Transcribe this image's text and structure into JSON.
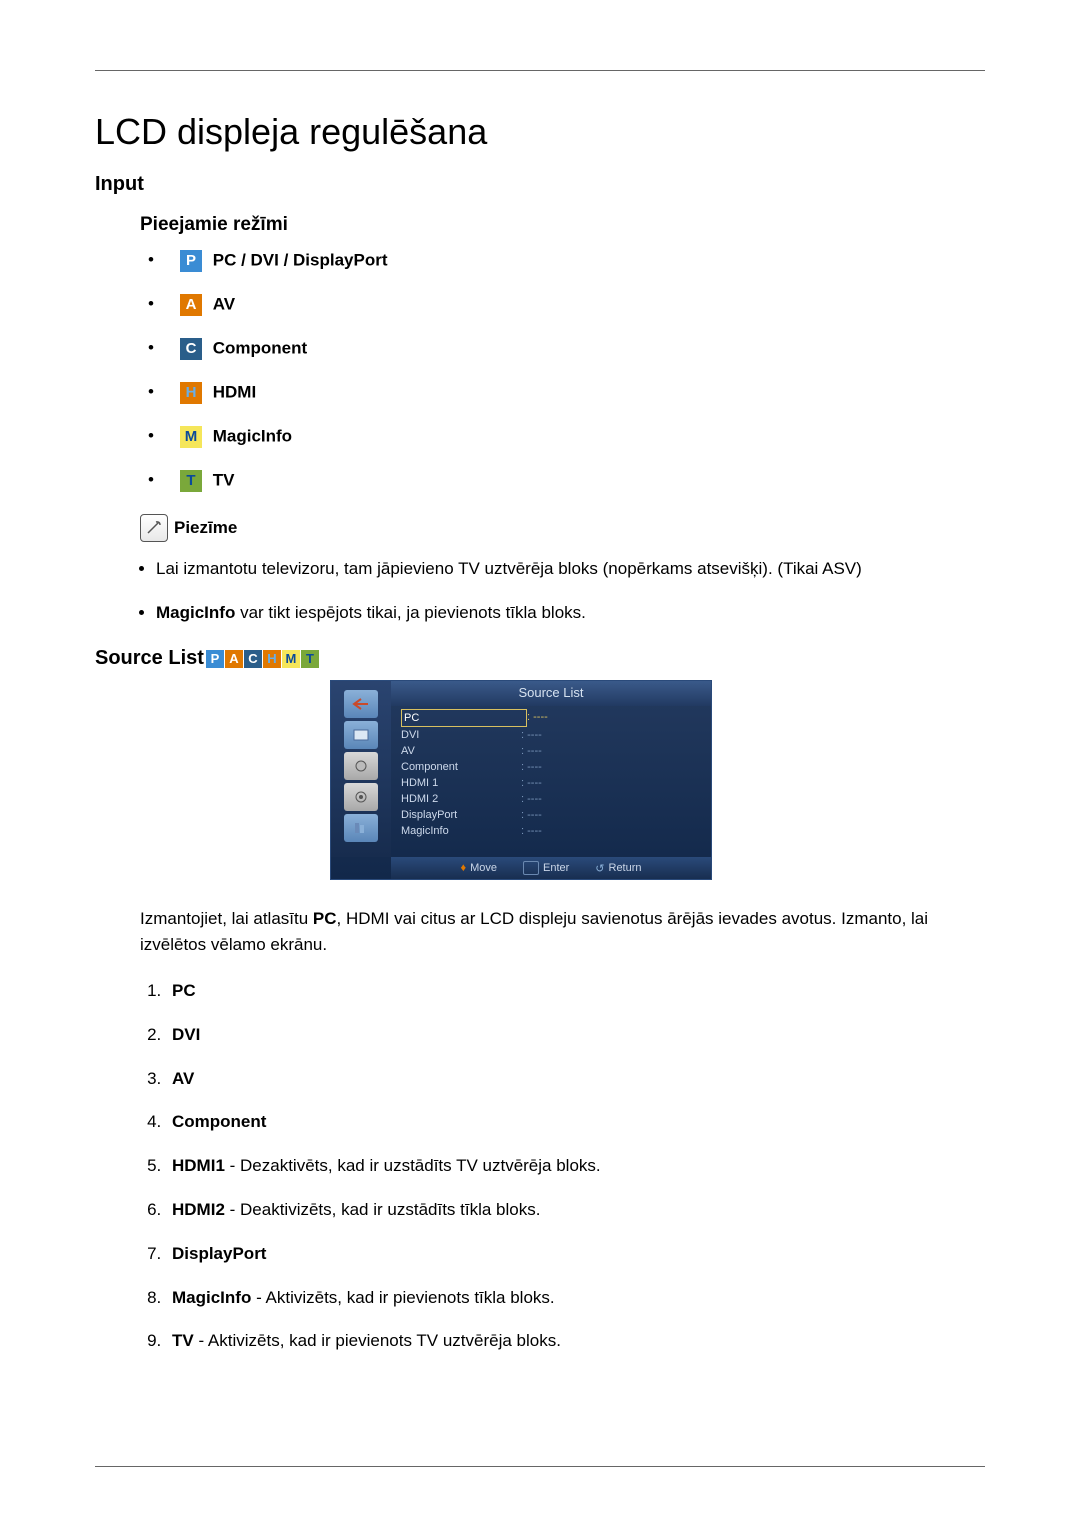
{
  "title": "LCD displeja regulēšana",
  "input": {
    "heading": "Input",
    "modes_heading": "Pieejamie režīmi",
    "modes": {
      "pc": "PC / DVI / DisplayPort",
      "av": "AV",
      "component": "Component",
      "hdmi": "HDMI",
      "magicinfo": "MagicInfo",
      "tv": "TV"
    },
    "note_label": "Piezīme",
    "notes": {
      "n1": "Lai izmantotu televizoru, tam jāpievieno TV uztvērēja bloks (nopērkams atsevišķi). (Tikai ASV)",
      "n2_bold": "MagicInfo",
      "n2_rest": " var tikt iespējots tikai, ja pievienots tīkla bloks."
    }
  },
  "source_list": {
    "heading": "Source List",
    "osd_title": "Source List",
    "osd_items": {
      "i0": {
        "label": "PC",
        "val": ": ----"
      },
      "i1": {
        "label": "DVI",
        "val": ": ----"
      },
      "i2": {
        "label": "AV",
        "val": ": ----"
      },
      "i3": {
        "label": "Component",
        "val": ": ----"
      },
      "i4": {
        "label": "HDMI 1",
        "val": ": ----"
      },
      "i5": {
        "label": "HDMI 2",
        "val": ": ----"
      },
      "i6": {
        "label": "DisplayPort",
        "val": ": ----"
      },
      "i7": {
        "label": "MagicInfo",
        "val": ": ----"
      }
    },
    "osd_hints": {
      "move": "Move",
      "enter": "Enter",
      "ret": "Return"
    },
    "intro_pre": "Izmantojiet, lai atlasītu ",
    "intro_bold": "PC",
    "intro_post": ", HDMI vai citus ar LCD displeju savienotus ārējās ievades avotus. Izmanto, lai izvēlētos vēlamo ekrānu.",
    "list": {
      "l1": "PC",
      "l2": "DVI",
      "l3": "AV",
      "l4": "Component",
      "l5b": "HDMI1",
      "l5r": " - Dezaktivēts, kad ir uzstādīts TV uztvērēja bloks.",
      "l6b": "HDMI2",
      "l6r": " - Deaktivizēts, kad ir uzstādīts tīkla bloks.",
      "l7": "DisplayPort",
      "l8b": "MagicInfo",
      "l8r": " - Aktivizēts, kad ir pievienots tīkla bloks.",
      "l9b": "TV",
      "l9r": " - Aktivizēts, kad ir pievienots TV uztvērēja bloks."
    }
  }
}
